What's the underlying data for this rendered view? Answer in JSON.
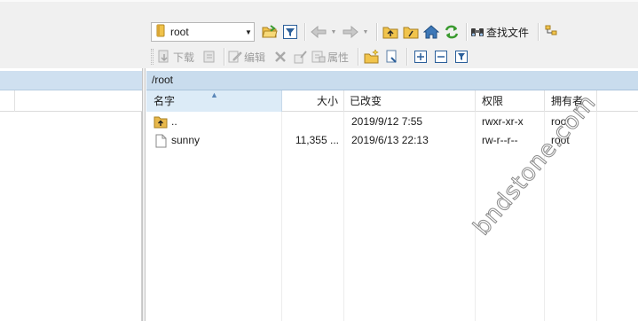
{
  "toolbar": {
    "path_combo": {
      "value": "root"
    },
    "search_files_label": "查找文件",
    "download_label": "下载",
    "edit_label": "编辑",
    "properties_label": "属性"
  },
  "right_pane": {
    "path": "/root",
    "columns": {
      "name": "名字",
      "size": "大小",
      "modified": "已改变",
      "permissions": "权限",
      "owner": "拥有者"
    },
    "files": [
      {
        "name": "..",
        "size": "",
        "modified": "2019/9/12 7:55",
        "permissions": "rwxr-xr-x",
        "owner": "root",
        "icon": "parent-folder-icon"
      },
      {
        "name": "sunny",
        "size": "11,355 ...",
        "modified": "2019/6/13 22:13",
        "permissions": "rw-r--r--",
        "owner": "root",
        "icon": "file-icon"
      }
    ]
  },
  "watermark": "bndstone.com",
  "colors": {
    "path_bar": "#c9dced",
    "header_active": "#dcebf7",
    "toolbar_bg": "#f0f0f0",
    "folder_yellow": "#e8b84a",
    "refresh_green": "#3a9a2f"
  }
}
